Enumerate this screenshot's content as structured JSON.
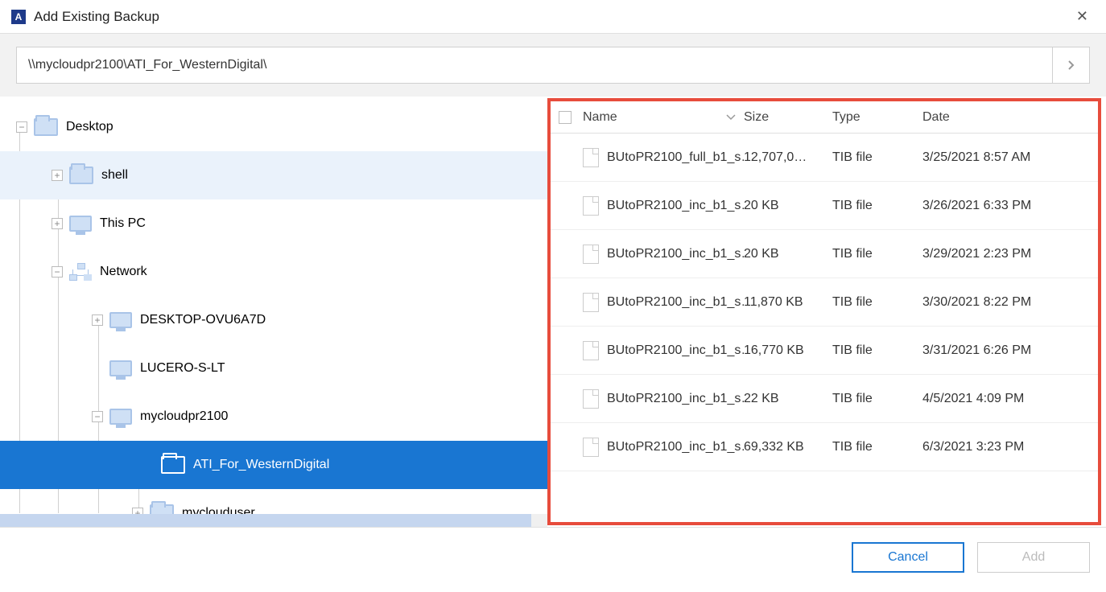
{
  "window": {
    "title": "Add Existing Backup",
    "app_letter": "A"
  },
  "path": "\\\\mycloudpr2100\\ATI_For_WesternDigital\\",
  "tree": {
    "desktop": "Desktop",
    "shell": "shell",
    "thispc": "This PC",
    "network": "Network",
    "node1": "DESKTOP-OVU6A7D",
    "node2": "LUCERO-S-LT",
    "node3": "mycloudpr2100",
    "folder_sel": "ATI_For_WesternDigital",
    "folder_user": "myclouduser"
  },
  "columns": {
    "name": "Name",
    "size": "Size",
    "type": "Type",
    "date": "Date"
  },
  "files": [
    {
      "name": "BUtoPR2100_full_b1_s…",
      "size": "12,707,0…",
      "type": "TIB file",
      "date": "3/25/2021 8:57 AM"
    },
    {
      "name": "BUtoPR2100_inc_b1_s…",
      "size": "20 KB",
      "type": "TIB file",
      "date": "3/26/2021 6:33 PM"
    },
    {
      "name": "BUtoPR2100_inc_b1_s…",
      "size": "20 KB",
      "type": "TIB file",
      "date": "3/29/2021 2:23 PM"
    },
    {
      "name": "BUtoPR2100_inc_b1_s…",
      "size": "11,870 KB",
      "type": "TIB file",
      "date": "3/30/2021 8:22 PM"
    },
    {
      "name": "BUtoPR2100_inc_b1_s…",
      "size": "16,770 KB",
      "type": "TIB file",
      "date": "3/31/2021 6:26 PM"
    },
    {
      "name": "BUtoPR2100_inc_b1_s…",
      "size": "22 KB",
      "type": "TIB file",
      "date": "4/5/2021 4:09 PM"
    },
    {
      "name": "BUtoPR2100_inc_b1_s…",
      "size": "69,332 KB",
      "type": "TIB file",
      "date": "6/3/2021 3:23 PM"
    }
  ],
  "buttons": {
    "cancel": "Cancel",
    "add": "Add"
  }
}
